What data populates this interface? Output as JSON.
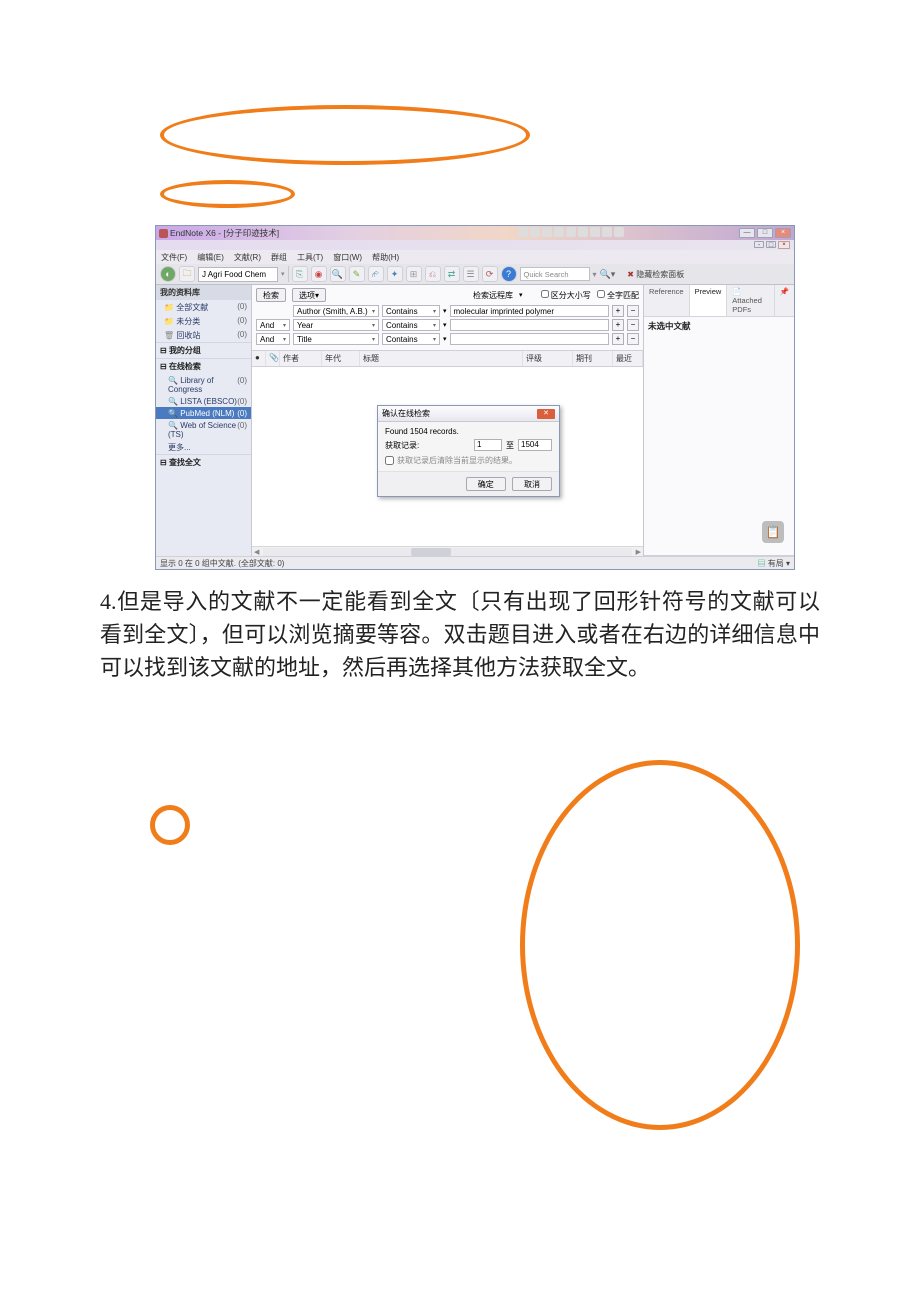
{
  "window": {
    "title": "EndNote X6 - [分子印迹技术]"
  },
  "menubar": [
    "文件(F)",
    "编辑(E)",
    "文献(R)",
    "群组",
    "工具(T)",
    "窗口(W)",
    "帮助(H)"
  ],
  "toolbar": {
    "style": "J Agri Food Chem",
    "quick_search": "Quick Search",
    "hide_panel": "隐藏检索面板"
  },
  "sidebar": {
    "header": "我的资料库",
    "top_items": [
      {
        "label": "全部文献",
        "count": "(0)"
      },
      {
        "label": "未分类",
        "count": "(0)"
      },
      {
        "label": "回收站",
        "count": "(0)"
      }
    ],
    "groups": [
      {
        "title": "我的分组",
        "items": []
      },
      {
        "title": "在线检索",
        "items": [
          {
            "label": "Library of Congress",
            "count": "(0)"
          },
          {
            "label": "LISTA (EBSCO)",
            "count": "(0)"
          },
          {
            "label": "PubMed (NLM)",
            "count": "(0)",
            "selected": true
          },
          {
            "label": "Web of Science (TS)",
            "count": "(0)"
          },
          {
            "label": "更多...",
            "count": ""
          }
        ]
      },
      {
        "title": "查找全文",
        "items": []
      }
    ]
  },
  "search": {
    "btn_search": "检索",
    "btn_options": "选项",
    "label_dest": "检索远程库",
    "chk_case": "区分大小写",
    "chk_word": "全字匹配",
    "rows": [
      {
        "and": "",
        "field": "Author (Smith, A.B.)",
        "op": "Contains",
        "value": "molecular imprinted polymer"
      },
      {
        "and": "And",
        "field": "Year",
        "op": "Contains",
        "value": ""
      },
      {
        "and": "And",
        "field": "Title",
        "op": "Contains",
        "value": ""
      }
    ]
  },
  "columns": {
    "author": "作者",
    "year": "年代",
    "title": "标题",
    "rating": "评级",
    "journal": "期刊",
    "last": "最近"
  },
  "dialog": {
    "title": "确认在线检索",
    "found": "Found 1504 records.",
    "label_get": "获取记录:",
    "from": "1",
    "to_label": "至",
    "to": "1504",
    "chk": "获取记录后清除当前显示的结果。",
    "ok": "确定",
    "cancel": "取消"
  },
  "right": {
    "tabs": [
      "Reference",
      "Preview",
      "Attached PDFs"
    ],
    "text": "未选中文献"
  },
  "status": {
    "left": "显示 0 在 0 组中文献. (全部文献: 0)",
    "right": "有局"
  },
  "paragraph": {
    "num": "4.",
    "text": "但是导入的文献不一定能看到全文〔只有出现了回形针符号的文献可以看到全文〕，但可以浏览摘要等容。双击题目进入或者在右边的详细信息中可以找到该文献的地址，然后再选择其他方法获取全文。"
  }
}
